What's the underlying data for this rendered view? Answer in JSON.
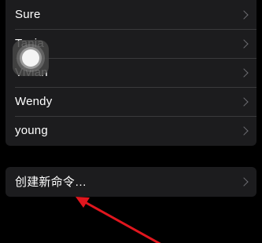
{
  "contacts": {
    "items": [
      {
        "label": "Sure"
      },
      {
        "label": "Tania"
      },
      {
        "label": "Vivian"
      },
      {
        "label": "Wendy"
      },
      {
        "label": "young"
      }
    ]
  },
  "actions": {
    "create_command_label": "创建新命令…"
  },
  "colors": {
    "background": "#000000",
    "cell_background": "#1c1c1e",
    "separator": "#3a3a3c",
    "chevron": "#6d6d72",
    "annotation_arrow": "#e0161e"
  },
  "icons": {
    "disclosure": "chevron-right-icon",
    "assistive_touch": "assistive-touch-icon"
  }
}
